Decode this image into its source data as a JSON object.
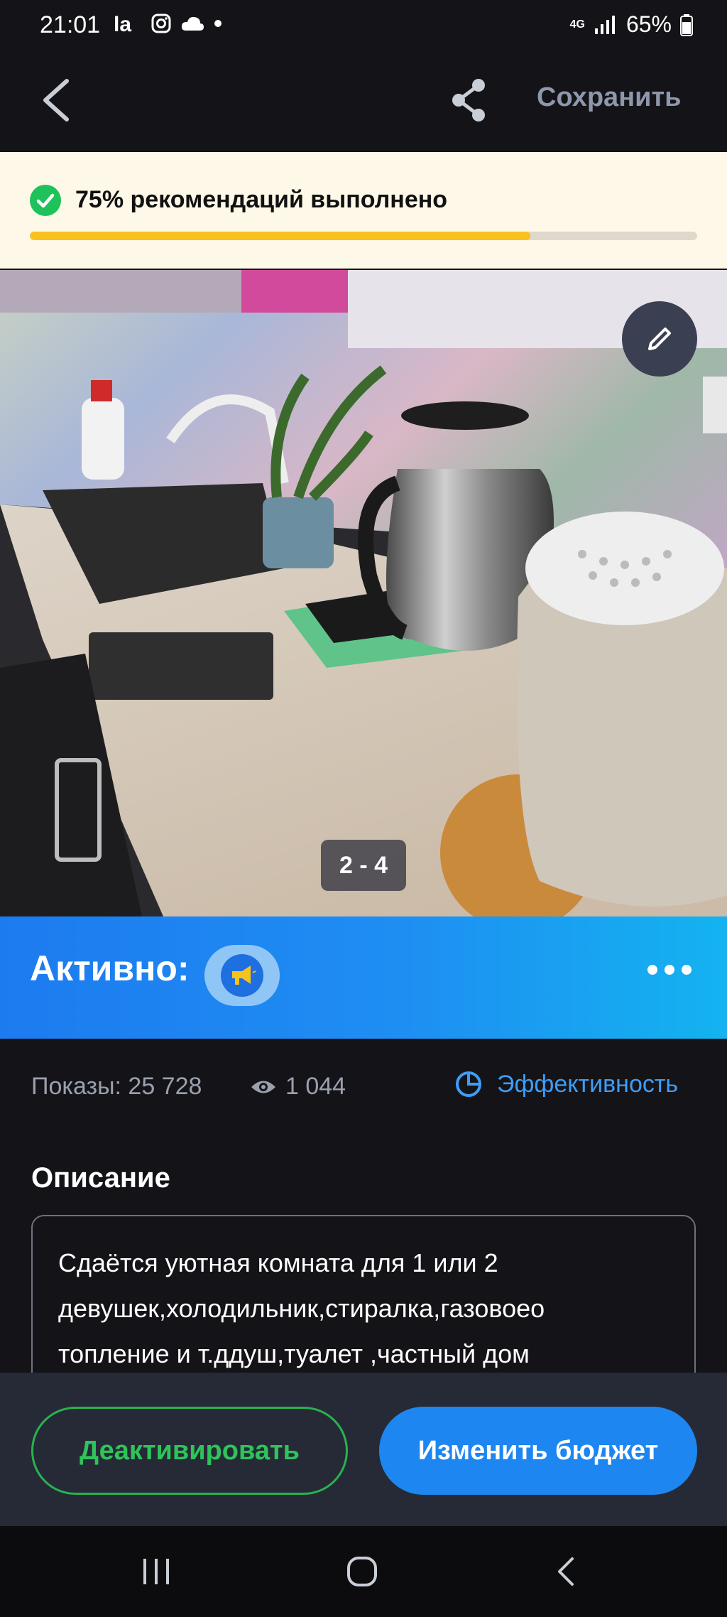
{
  "status_bar": {
    "time": "21:01",
    "network": "4G",
    "battery": "65%"
  },
  "app_bar": {
    "save_label": "Сохранить"
  },
  "recommendations": {
    "text": "75% рекомендаций выполнено",
    "progress_fraction": 0.75,
    "colors": {
      "fill": "#f7c21c",
      "check": "#1fc15a"
    }
  },
  "photo": {
    "counter": "2 - 4"
  },
  "promotion": {
    "status_label": "Активно:",
    "badge_icon": "megaphone-icon",
    "colors": {
      "start": "#1d7bf0",
      "end": "#14b3f0"
    }
  },
  "stats": {
    "impressions": "Показы: 25 728",
    "views": "1 044",
    "efficiency_label": "Эффективность",
    "accent_color": "#3e9df5"
  },
  "description": {
    "title": "Описание",
    "lines": [
      "Сдаётся уютная комната для 1 или 2",
      "девушек,холодильник,стиралка,газовоеo",
      "топление и т.ддуш,туалет ,частный дом"
    ]
  },
  "actions": {
    "deactivate_label": "Деактивировать",
    "budget_label": "Изменить бюджет",
    "colors": {
      "deactivate": "#2ec45a",
      "budget": "#1d86f0"
    }
  }
}
